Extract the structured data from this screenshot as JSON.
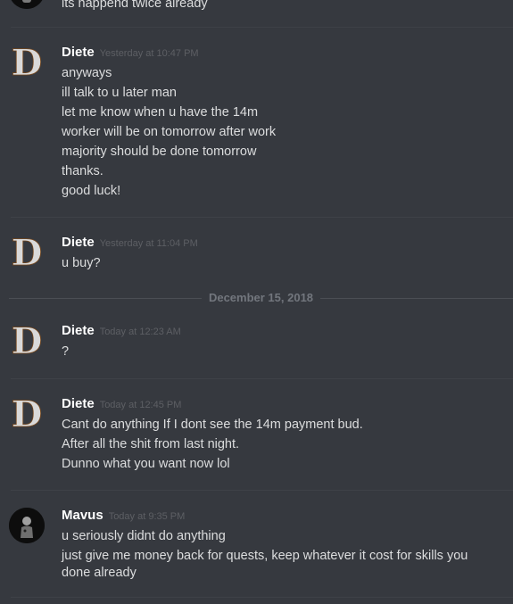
{
  "chat": {
    "top_partial": {
      "line": "its happend twice already"
    },
    "messages": [
      {
        "author": "Diete",
        "timestamp": "Yesterday at 10:47 PM",
        "lines": [
          "anyways",
          "ill talk to u later man",
          "let me know when u have the 14m",
          "worker will be on tomorrow after work",
          "majority should be done tomorrow",
          "thanks.",
          "good luck!"
        ]
      },
      {
        "author": "Diete",
        "timestamp": "Yesterday at 11:04 PM",
        "lines": [
          "u buy?"
        ]
      },
      {
        "author": "Diete",
        "timestamp": "Today at 12:23 AM",
        "lines": [
          "?"
        ]
      },
      {
        "author": "Diete",
        "timestamp": "Today at 12:45 PM",
        "lines": [
          "Cant do anything If I dont see the 14m payment bud.",
          "After all the shit from last night.",
          "Dunno what you want now lol"
        ]
      },
      {
        "author": "Mavus",
        "timestamp": "Today at 9:35 PM",
        "lines": [
          "u seriously didnt do anything",
          "just give me money back for quests, keep whatever it cost for skills you done already"
        ]
      }
    ],
    "date_separator": "December 15, 2018"
  }
}
